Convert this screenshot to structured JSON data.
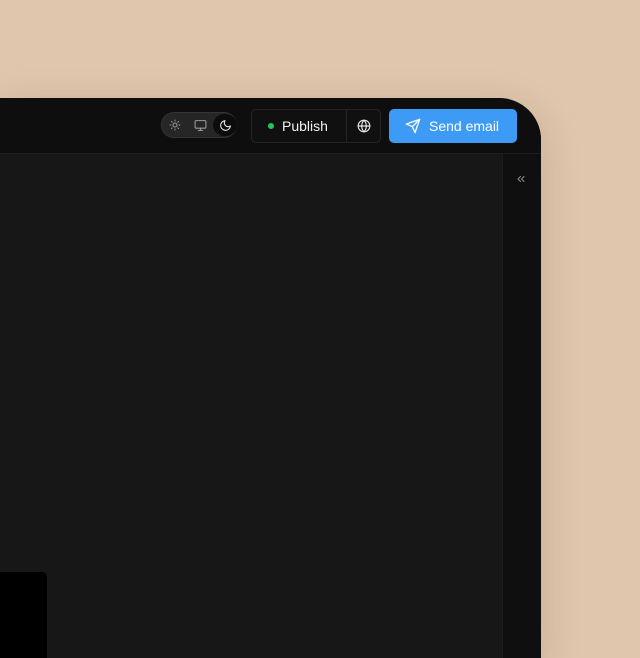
{
  "toolbar": {
    "theme_options": [
      {
        "name": "light",
        "icon": "sun-icon",
        "active": false
      },
      {
        "name": "system",
        "icon": "monitor-icon",
        "active": false
      },
      {
        "name": "dark",
        "icon": "moon-icon",
        "active": true
      }
    ],
    "publish_label": "Publish",
    "publish_status_color": "#22c55e",
    "globe_icon": "globe-icon",
    "send_label": "Send email",
    "send_icon": "send-icon",
    "send_color": "#3d9bf5"
  },
  "sidebar": {
    "collapse_icon": "chevrons-left-icon"
  },
  "colors": {
    "background": "#dfc6ad",
    "frame": "#0f0f0f",
    "canvas": "#171717"
  }
}
